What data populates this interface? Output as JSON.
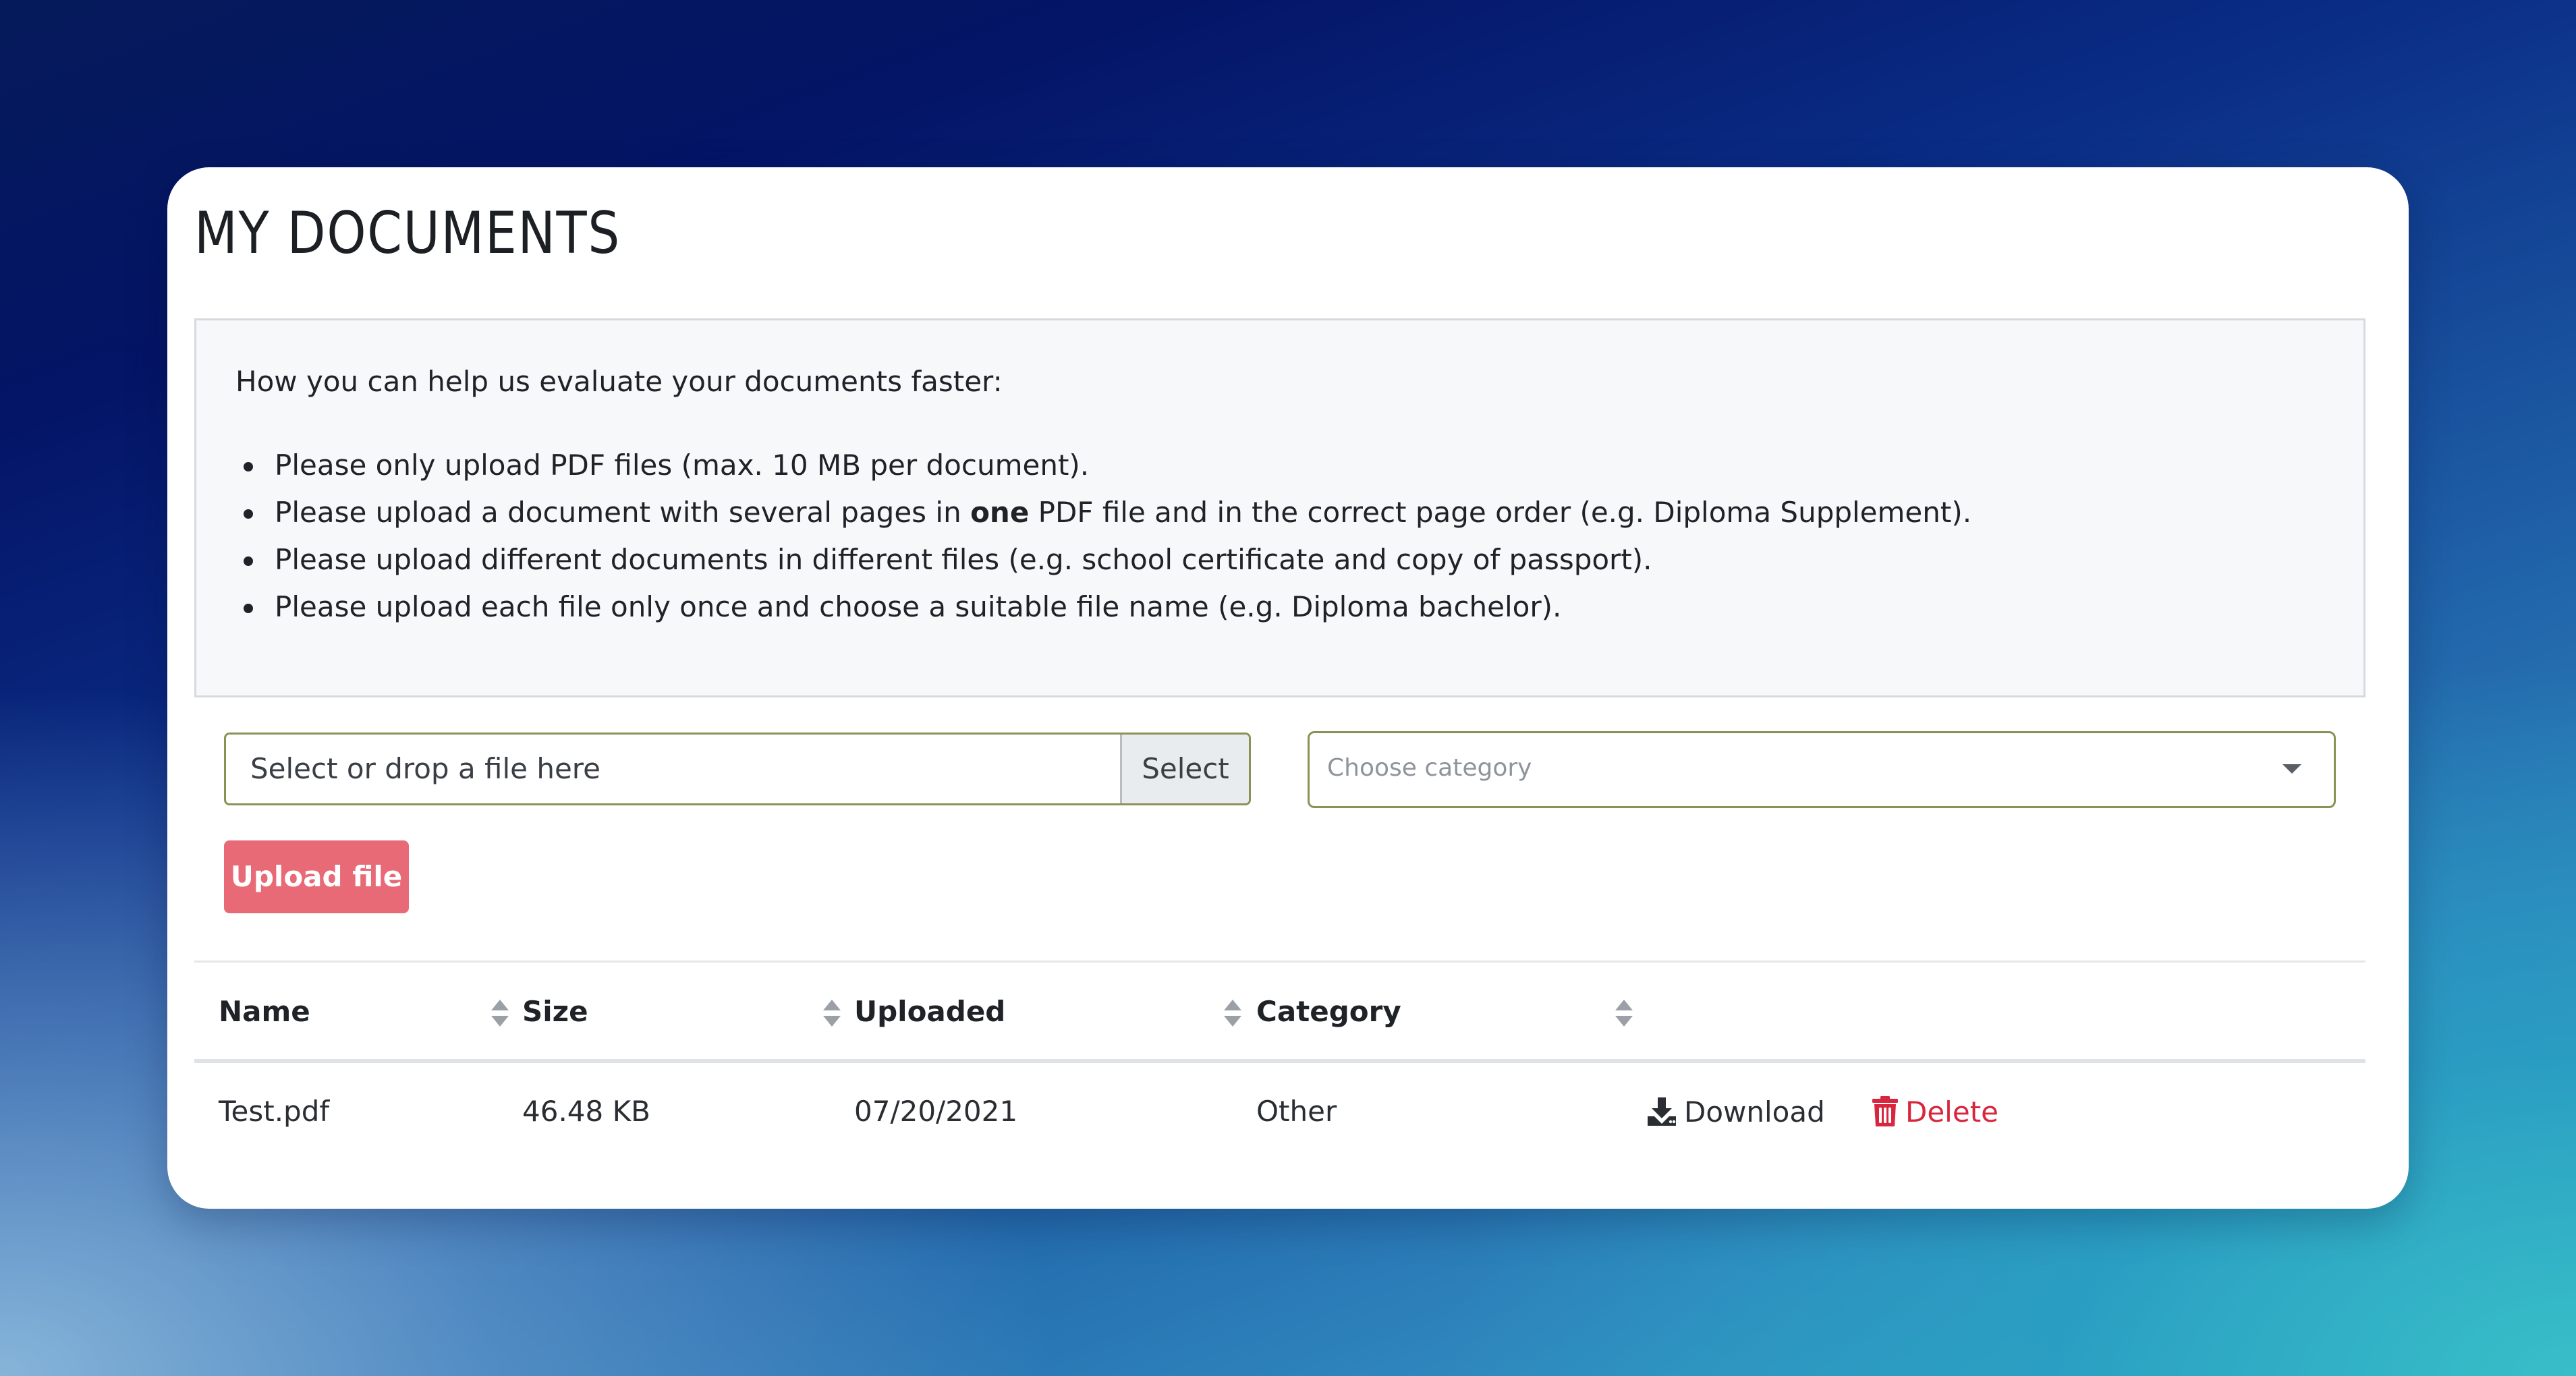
{
  "page": {
    "title": "MY DOCUMENTS"
  },
  "info": {
    "intro": "How you can help us evaluate your documents faster:",
    "bullets": [
      {
        "text": "Please only upload PDF files (max. 10 MB per document)."
      },
      {
        "before": "Please upload a document with several pages in ",
        "bold": "one",
        "after": " PDF file and in the correct page order (e.g. Diploma Supplement)."
      },
      {
        "text": "Please upload different documents in different files (e.g. school certificate and copy of passport)."
      },
      {
        "text": "Please upload each file only once and choose a suitable file name (e.g. Diploma bachelor)."
      }
    ]
  },
  "upload": {
    "file_placeholder": "Select or drop a file here",
    "select_label": "Select",
    "category_placeholder": "Choose category",
    "upload_label": "Upload file"
  },
  "table": {
    "columns": [
      "Name",
      "Size",
      "Uploaded",
      "Category"
    ],
    "rows": [
      {
        "name": "Test.pdf",
        "size": "46.48 KB",
        "uploaded": "07/20/2021",
        "category": "Other",
        "download_label": "Download",
        "delete_label": "Delete"
      }
    ]
  },
  "colors": {
    "accent_button": "#e86a77",
    "delete": "#d7263d",
    "input_border": "#8c9157"
  },
  "icons": {
    "sort": "sort-icon",
    "download": "download-icon",
    "delete": "trash-icon",
    "dropdown": "chevron-down-icon"
  }
}
